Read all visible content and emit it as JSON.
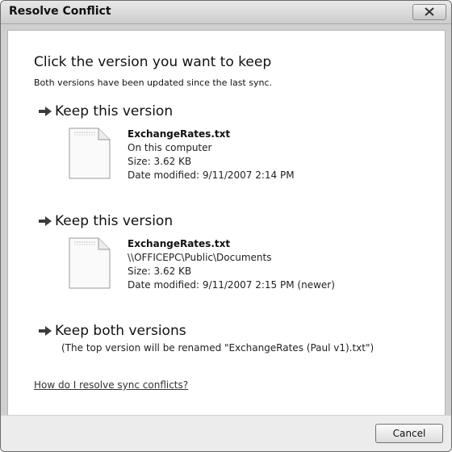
{
  "window": {
    "title": "Resolve Conflict"
  },
  "main": {
    "instruction": "Click the version you want to keep",
    "subtext": "Both versions have been updated since the last sync.",
    "options": [
      {
        "label": "Keep this version",
        "file": {
          "name": "ExchangeRates.txt",
          "location": "On this computer",
          "size": "Size: 3.62 KB",
          "modified": "Date modified: 9/11/2007 2:14 PM"
        }
      },
      {
        "label": "Keep this version",
        "file": {
          "name": "ExchangeRates.txt",
          "location": "\\\\OFFICEPC\\Public\\Documents",
          "size": "Size: 3.62 KB",
          "modified": "Date modified: 9/11/2007 2:15 PM (newer)"
        }
      },
      {
        "label": "Keep both versions",
        "note": "(The top version will be renamed \"ExchangeRates (Paul v1).txt\")"
      }
    ],
    "help_link": "How do I resolve sync conflicts?"
  },
  "footer": {
    "cancel_label": "Cancel"
  },
  "icons": {
    "option_arrow": "arrow-right-icon",
    "file": "text-file-icon",
    "close": "close-icon"
  }
}
